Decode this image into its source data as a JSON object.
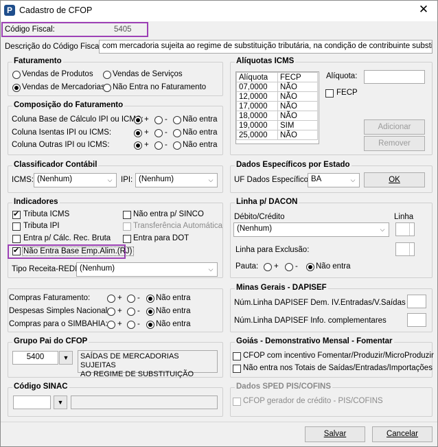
{
  "window": {
    "title": "Cadastro de CFOP",
    "icon_letter": "P",
    "close": "✕"
  },
  "codigo": {
    "label": "Código Fiscal:",
    "value": "5405"
  },
  "descricao": {
    "label": "Descrição do Código Fiscal:",
    "value": "com mercadoria sujeita ao regime de substituição tributária, na condição de contribuinte substituído"
  },
  "faturamento": {
    "title": "Faturamento",
    "options": [
      "Vendas de Produtos",
      "Vendas de Serviços",
      "Vendas de Mercadorias",
      "Não Entra no Faturamento"
    ],
    "selected": "Vendas de Mercadorias"
  },
  "composicao": {
    "title": "Composição do Faturamento",
    "rows": [
      "Coluna Base de Cálculo IPI ou ICMS:",
      "Coluna Isentas IPI ou ICMS:",
      "Coluna Outras IPI ou ICMS:"
    ],
    "plus": "+",
    "minus": "-",
    "none": "Não entra"
  },
  "aliquotas": {
    "title": "Alíquotas ICMS",
    "headers": [
      "Alíquota",
      "FECP"
    ],
    "rows": [
      [
        "07,0000",
        "NÃO"
      ],
      [
        "12,0000",
        "NÃO"
      ],
      [
        "17,0000",
        "NÃO"
      ],
      [
        "18,0000",
        "NÃO"
      ],
      [
        "19,0000",
        "SIM"
      ],
      [
        "25,0000",
        "NÃO"
      ]
    ],
    "aliquota_label": "Alíquota:",
    "fecp_label": "FECP",
    "add": "Adicionar",
    "remove": "Remover"
  },
  "classificador": {
    "title": "Classificador Contábil",
    "icms_label": "ICMS:",
    "icms_value": "(Nenhum)",
    "ipi_label": "IPI:",
    "ipi_value": "(Nenhum)"
  },
  "estado": {
    "title": "Dados Específicos por Estado",
    "uf_label": "UF Dados Específicos:",
    "uf_value": "BA",
    "ok": "OK"
  },
  "indicadores": {
    "title": "Indicadores",
    "tributa_icms": "Tributa ICMS",
    "tributa_ipi": "Tributa IPI",
    "entra_calc": "Entra p/ Cálc. Rec. Bruta",
    "nao_entra_base": "Não Entra Base Emp.Alim.(RJ)",
    "nao_sinco": "Não entra p/ SINCO",
    "transferencia": "Transferência Automática",
    "entra_dot": "Entra para DOT",
    "tipo_receita_label": "Tipo Receita-REDF:",
    "tipo_receita_value": "(Nenhum)"
  },
  "dacon": {
    "title": "Linha p/ DACON",
    "debito_label": "Débito/Crédito",
    "linha_label": "Linha",
    "debito_value": "(Nenhum)",
    "exclusao_label": "Linha para Exclusão:",
    "pauta_label": "Pauta:",
    "plus": "+",
    "minus": "-",
    "none": "Não entra"
  },
  "compras": {
    "rows": [
      "Compras Faturamento:",
      "Despesas Simples Nacional:",
      "Compras para o SIMBAHIA:"
    ],
    "plus": "+",
    "minus": "-",
    "none": "Não entra"
  },
  "minas": {
    "title": "Minas Gerais - DAPISEF",
    "row1": "Núm.Linha DAPISEF Dem. IV.Entradas/V.Saídas",
    "row2": "Núm.Linha DAPISEF Info. complementares"
  },
  "grupo": {
    "title": "Grupo Pai do CFOP",
    "code": "5400",
    "desc_line1": "SAÍDAS DE MERCADORIAS SUJEITAS",
    "desc_line2": "AO REGIME DE SUBSTITUIÇÃO"
  },
  "goias": {
    "title": "Goiás - Demonstrativo Mensal - Fomentar",
    "opt1": "CFOP com incentivo  Fomentar/Produzir/MicroProduzir",
    "opt2": "Não entra nos Totais de  Saídas/Entradas/Importações"
  },
  "sinac": {
    "title": "Código SINAC"
  },
  "sped": {
    "title": "Dados SPED PIS/COFINS",
    "opt": "CFOP gerador de crédito - PIS/COFINS"
  },
  "footer": {
    "save": "Salvar",
    "cancel": "Cancelar"
  }
}
